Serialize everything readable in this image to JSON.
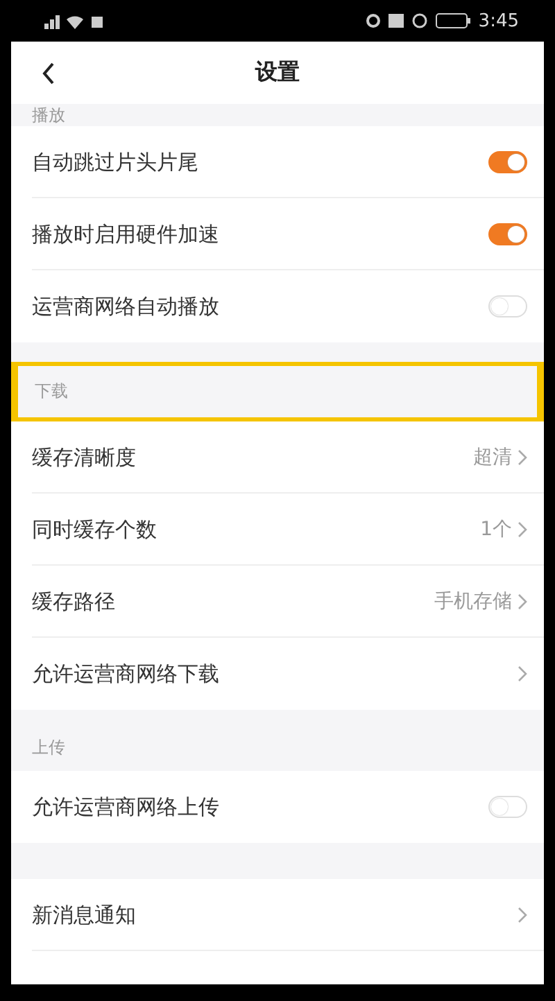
{
  "status_bar": {
    "time": "3:45"
  },
  "nav": {
    "title": "设置"
  },
  "sections": [
    {
      "header": "播放",
      "highlighted": false,
      "rows": [
        {
          "kind": "toggle",
          "label": "自动跳过片头片尾",
          "on": true
        },
        {
          "kind": "toggle",
          "label": "播放时启用硬件加速",
          "on": true
        },
        {
          "kind": "toggle",
          "label": "运营商网络自动播放",
          "on": false
        }
      ]
    },
    {
      "header": "下载",
      "highlighted": true,
      "rows": [
        {
          "kind": "link",
          "label": "缓存清晰度",
          "value": "超清"
        },
        {
          "kind": "link",
          "label": "同时缓存个数",
          "value": "1个"
        },
        {
          "kind": "link",
          "label": "缓存路径",
          "value": "手机存储"
        },
        {
          "kind": "link",
          "label": "允许运营商网络下载"
        }
      ]
    },
    {
      "header": "上传",
      "highlighted": false,
      "rows": [
        {
          "kind": "toggle",
          "label": "允许运营商网络上传",
          "on": false
        }
      ]
    },
    {
      "highlighted": false,
      "rows": [
        {
          "kind": "link",
          "label": "新消息通知"
        }
      ]
    }
  ]
}
